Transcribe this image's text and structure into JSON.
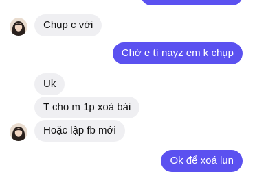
{
  "conversation": {
    "messages": [
      {
        "direction": "incoming",
        "text": "Chụp c với"
      },
      {
        "direction": "outgoing",
        "text": "Chờ e tí nayz em k chụp"
      },
      {
        "direction": "incoming",
        "text": "Uk"
      },
      {
        "direction": "incoming",
        "text": "T cho m 1p xoá bài"
      },
      {
        "direction": "incoming",
        "text": "Hoặc lập fb mới"
      },
      {
        "direction": "outgoing",
        "text": "Ok để xoá lun"
      }
    ]
  },
  "colors": {
    "incoming_bubble": "#efeff2",
    "outgoing_bubble": "#5b51f0",
    "outgoing_text": "#ffffff"
  },
  "icons": {
    "sender_avatar": "contact-avatar"
  }
}
